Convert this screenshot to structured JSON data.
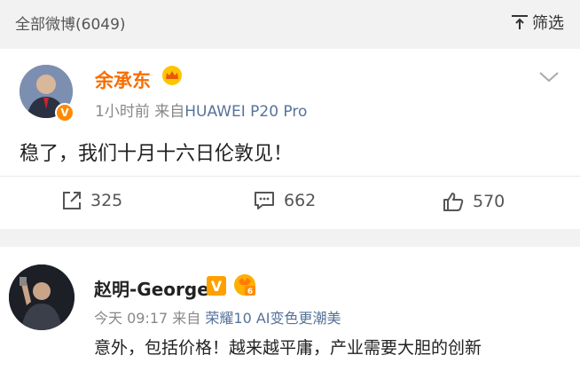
{
  "header": {
    "count_label": "全部微博(6049)",
    "filter_label": "筛选"
  },
  "post1": {
    "author": "余承东",
    "time": "1小时前",
    "from": "来自",
    "source": "HUAWEI P20 Pro",
    "text": "稳了，我们十月十六日伦敦见！",
    "actions": {
      "repost": "325",
      "comment": "662",
      "like": "570"
    },
    "colors": {
      "name": "#f86d00",
      "source": "#56739a"
    }
  },
  "post2": {
    "author": "赵明-George",
    "time": "今天 09:17",
    "from": "来自",
    "source": "荣耀10 AI变色更潮美",
    "text": "意外，包括价格！越来越平庸，产业需要大胆的创新"
  }
}
